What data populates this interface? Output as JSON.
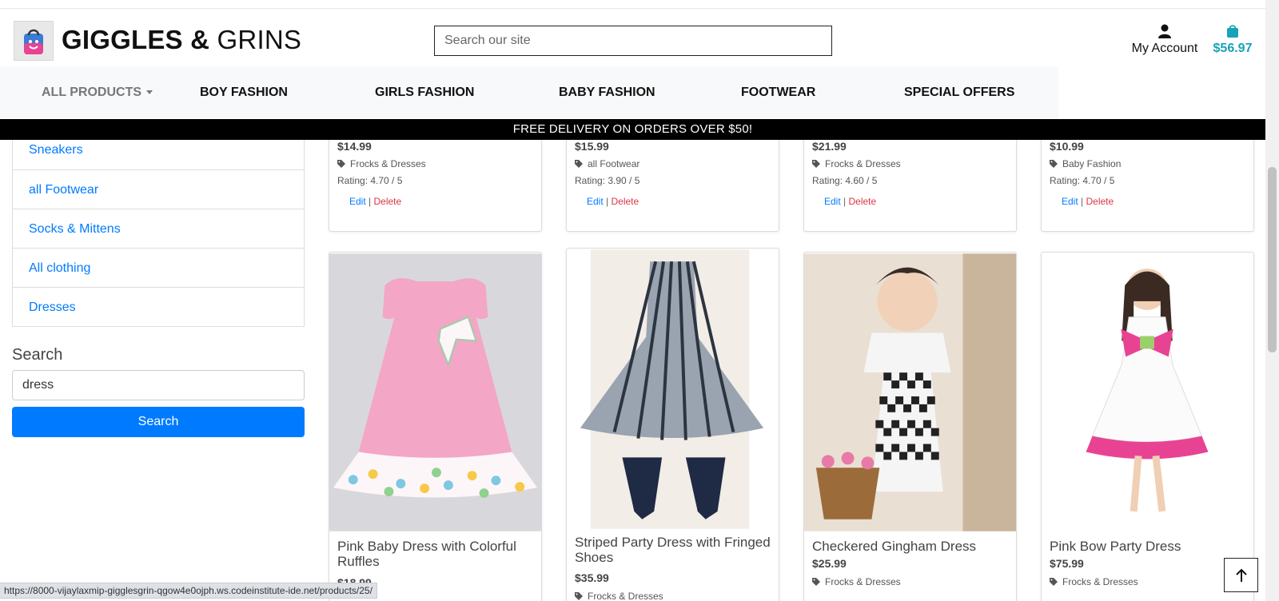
{
  "header": {
    "brand_bold": "GIGGLES",
    "brand_amp": " & ",
    "brand_rest": "GRINS",
    "search_placeholder": "Search our site",
    "account_label": "My Account",
    "bag_total": "$56.97",
    "accent_color": "#17a2b8"
  },
  "nav": {
    "items": [
      "ALL PRODUCTS",
      "BOY FASHION",
      "GIRLS FASHION",
      "BABY FASHION",
      "FOOTWEAR",
      "SPECIAL OFFERS"
    ]
  },
  "banner": {
    "text": "FREE DELIVERY ON ORDERS OVER $50!"
  },
  "sidebar": {
    "categories": [
      "Sneakers",
      "all Footwear",
      "Socks & Mittens",
      "All clothing",
      "Dresses"
    ],
    "search_heading": "Search",
    "search_value": "dress",
    "search_button": "Search"
  },
  "products_top": [
    {
      "price": "$14.99",
      "category": "Frocks & Dresses",
      "rating": "Rating: 4.70 / 5",
      "edit": "Edit",
      "sep": " | ",
      "delete": "Delete"
    },
    {
      "price": "$15.99",
      "category": "all Footwear",
      "rating": "Rating: 3.90 / 5",
      "edit": "Edit",
      "sep": " | ",
      "delete": "Delete"
    },
    {
      "price": "$21.99",
      "category": "Frocks & Dresses",
      "rating": "Rating: 4.60 / 5",
      "edit": "Edit",
      "sep": " | ",
      "delete": "Delete"
    },
    {
      "price": "$10.99",
      "category": "Baby Fashion",
      "rating": "Rating: 4.70 / 5",
      "edit": "Edit",
      "sep": " | ",
      "delete": "Delete"
    }
  ],
  "products_bottom": [
    {
      "name": "Pink Baby Dress with Colorful Ruffles",
      "price": "$18.99",
      "category": ""
    },
    {
      "name": "Striped Party Dress with Fringed Shoes",
      "price": "$35.99",
      "category": "Frocks & Dresses"
    },
    {
      "name": "Checkered Gingham Dress",
      "price": "$25.99",
      "category": "Frocks & Dresses"
    },
    {
      "name": "Pink Bow Party Dress",
      "price": "$75.99",
      "category": "Frocks & Dresses"
    }
  ],
  "status_bar": {
    "url": "https://8000-vijaylaxmip-gigglesgrin-qgow4e0ojph.ws.codeinstitute-ide.net/products/25/"
  }
}
